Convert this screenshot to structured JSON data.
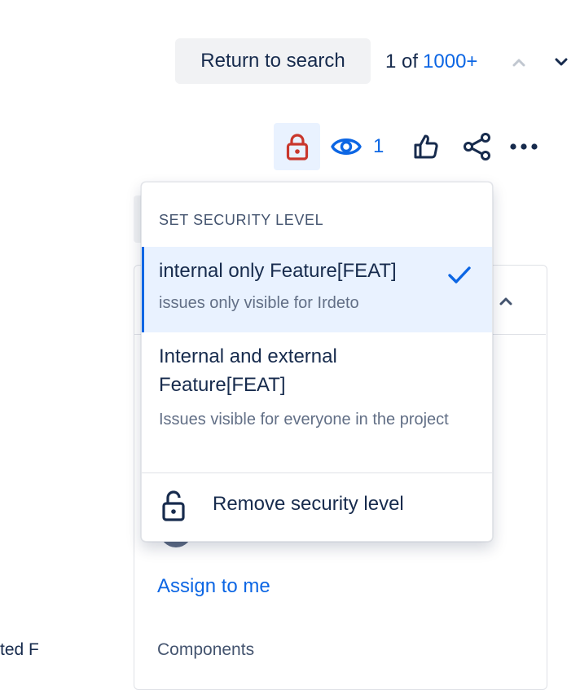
{
  "toolbar": {
    "return_label": "Return to search",
    "pager_prefix": "1 of",
    "pager_total": "1000+",
    "watch_count": "1"
  },
  "icons": {
    "lock": "lock-icon",
    "watch": "eye-icon",
    "like": "thumbs-up-icon",
    "share": "share-icon",
    "more": "more-icon",
    "prev": "chevron-up-icon",
    "next": "chevron-down-icon",
    "check": "check-icon",
    "unlock": "unlock-icon"
  },
  "colors": {
    "accent": "#0c66e4",
    "lock_red": "#c9372c",
    "selected_bg": "#e9f2ff",
    "text": "#172b4d",
    "subtle_text": "#626f86"
  },
  "security_menu": {
    "heading": "SET SECURITY LEVEL",
    "options": [
      {
        "title": "internal only Feature[FEAT]",
        "description": "issues only visible for Irdeto",
        "selected": true
      },
      {
        "title": "Internal and external Feature[FEAT]",
        "description": "Issues visible for everyone in the project",
        "selected": false
      }
    ],
    "remove_label": "Remove security level"
  },
  "details": {
    "assign_link": "Assign to me",
    "components_label": "Components",
    "left_edge_text": "ted F"
  }
}
